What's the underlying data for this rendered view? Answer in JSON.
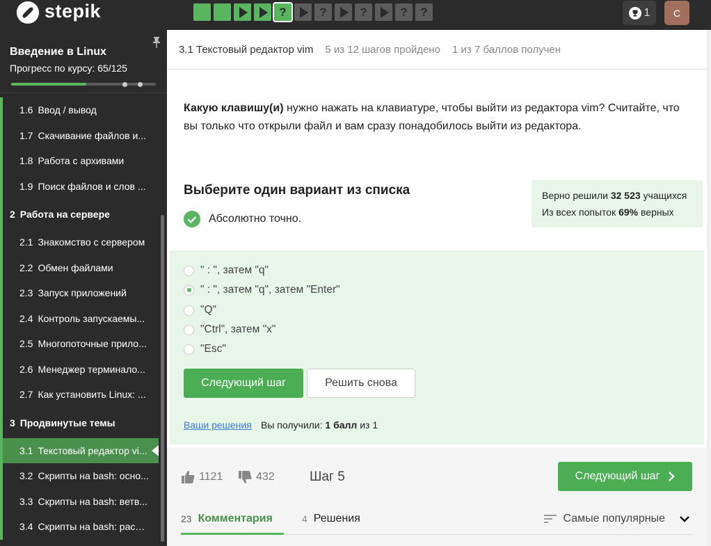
{
  "app": {
    "brand": "stepik"
  },
  "header": {
    "steps": [
      {
        "state": "done",
        "kind": "text"
      },
      {
        "state": "done",
        "kind": "text"
      },
      {
        "state": "done",
        "kind": "video"
      },
      {
        "state": "done",
        "kind": "video"
      },
      {
        "state": "current",
        "kind": "quiz"
      },
      {
        "state": "todo",
        "kind": "video"
      },
      {
        "state": "todo",
        "kind": "quiz"
      },
      {
        "state": "todo",
        "kind": "video"
      },
      {
        "state": "todo",
        "kind": "quiz"
      },
      {
        "state": "todo",
        "kind": "video"
      },
      {
        "state": "todo",
        "kind": "quiz"
      },
      {
        "state": "todo",
        "kind": "quiz"
      }
    ],
    "quiz_glyph": "?",
    "trophy_count": "1",
    "avatar_letter": "С"
  },
  "sidebar": {
    "course_title": "Введение в Linux",
    "progress_label": "Прогресс по курсу:  65/125",
    "progress_fraction": 0.52,
    "items": [
      {
        "num": "1.6",
        "label": "Ввод / вывод",
        "type": "lesson"
      },
      {
        "num": "1.7",
        "label": "Скачивание файлов и...",
        "type": "lesson"
      },
      {
        "num": "1.8",
        "label": "Работа с архивами",
        "type": "lesson"
      },
      {
        "num": "1.9",
        "label": "Поиск файлов и слов ...",
        "type": "lesson"
      },
      {
        "num": "2",
        "label": "Работа на сервере",
        "type": "section"
      },
      {
        "num": "2.1",
        "label": "Знакомство с сервером",
        "type": "lesson"
      },
      {
        "num": "2.2",
        "label": "Обмен файлами",
        "type": "lesson"
      },
      {
        "num": "2.3",
        "label": "Запуск приложений",
        "type": "lesson"
      },
      {
        "num": "2.4",
        "label": "Контроль запускаемы...",
        "type": "lesson"
      },
      {
        "num": "2.5",
        "label": "Многопоточные прило...",
        "type": "lesson"
      },
      {
        "num": "2.6",
        "label": "Менеджер терминало...",
        "type": "lesson"
      },
      {
        "num": "2.7",
        "label": "Как установить Linux: ...",
        "type": "lesson"
      },
      {
        "num": "3",
        "label": "Продвинутые темы",
        "type": "section"
      },
      {
        "num": "3.1",
        "label": "Текстовый редактор vi...",
        "type": "lesson",
        "active": true
      },
      {
        "num": "3.2",
        "label": "Скрипты на bash: осно...",
        "type": "lesson"
      },
      {
        "num": "3.3",
        "label": "Скрипты на bash: ветв...",
        "type": "lesson"
      },
      {
        "num": "3.4",
        "label": "Скрипты на bash: расш...",
        "type": "lesson"
      }
    ]
  },
  "lesson_header": {
    "title": "3.1 Текстовый редактор vim",
    "steps_passed": "5 из 12 шагов пройдено",
    "points": "1 из 7 баллов  получен"
  },
  "question": {
    "bold": "Какую клавишу(и)",
    "rest": " нужно нажать на клавиатуре, чтобы выйти из редактора vim? Считайте, что вы только что открыли файл и вам сразу понадобилось выйти из редактора."
  },
  "quiz": {
    "choose_title": "Выберите один вариант из списка",
    "correct_text": "Абсолютно точно.",
    "stats_solved_prefix": "Верно решили ",
    "stats_solved_count": "32 523",
    "stats_solved_suffix": " учащихся",
    "stats_attempts_prefix": "Из всех попыток ",
    "stats_attempts_pct": "69%",
    "stats_attempts_suffix": " верных",
    "options": [
      {
        "label": "\" : \", затем \"q\"",
        "selected": false
      },
      {
        "label": "\" : \", затем \"q\", затем \"Enter\"",
        "selected": true
      },
      {
        "label": "\"Q\"",
        "selected": false
      },
      {
        "label": "\"Ctrl\", затем \"x\"",
        "selected": false
      },
      {
        "label": "\"Esc\"",
        "selected": false
      }
    ],
    "next_button": "Следующий шаг",
    "retry_button": "Решить снова",
    "solutions_link": "Ваши решения",
    "score_prefix": "Вы получили: ",
    "score_bold": "1 балл",
    "score_suffix": " из 1"
  },
  "footer": {
    "likes": "1121",
    "dislikes": "432",
    "step_label": "Шаг 5",
    "next_button": "Следующий шаг",
    "tabs": [
      {
        "count": "23",
        "label": "Комментария",
        "active": true
      },
      {
        "count": "4",
        "label": "Решения",
        "active": false
      }
    ],
    "sort_label": "Самые популярные"
  },
  "colors": {
    "accent": "#59b560",
    "dark_bg": "#2b2b2b",
    "light_green": "#e8f5e9",
    "link": "#3a7bd5"
  }
}
